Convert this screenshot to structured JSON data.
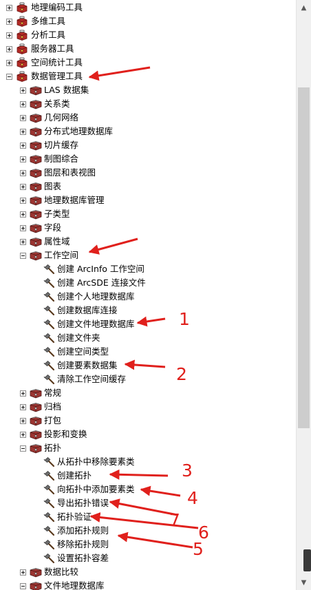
{
  "tree": {
    "items": [
      {
        "label": "地理编码工具",
        "level": 0,
        "expander": "plus",
        "icon": "toolbox-icon"
      },
      {
        "label": "多维工具",
        "level": 0,
        "expander": "plus",
        "icon": "toolbox-icon"
      },
      {
        "label": "分析工具",
        "level": 0,
        "expander": "plus",
        "icon": "toolbox-icon"
      },
      {
        "label": "服务器工具",
        "level": 0,
        "expander": "plus",
        "icon": "toolbox-icon"
      },
      {
        "label": "空间统计工具",
        "level": 0,
        "expander": "plus",
        "icon": "toolbox-icon"
      },
      {
        "label": "数据管理工具",
        "level": 0,
        "expander": "minus",
        "icon": "toolbox-icon"
      },
      {
        "label": "LAS 数据集",
        "level": 1,
        "expander": "plus",
        "icon": "toolset-icon"
      },
      {
        "label": "关系类",
        "level": 1,
        "expander": "plus",
        "icon": "toolset-icon"
      },
      {
        "label": "几何网络",
        "level": 1,
        "expander": "plus",
        "icon": "toolset-icon"
      },
      {
        "label": "分布式地理数据库",
        "level": 1,
        "expander": "plus",
        "icon": "toolset-icon"
      },
      {
        "label": "切片缓存",
        "level": 1,
        "expander": "plus",
        "icon": "toolset-icon"
      },
      {
        "label": "制图综合",
        "level": 1,
        "expander": "plus",
        "icon": "toolset-icon"
      },
      {
        "label": "图层和表视图",
        "level": 1,
        "expander": "plus",
        "icon": "toolset-icon"
      },
      {
        "label": "图表",
        "level": 1,
        "expander": "plus",
        "icon": "toolset-icon"
      },
      {
        "label": "地理数据库管理",
        "level": 1,
        "expander": "plus",
        "icon": "toolset-icon"
      },
      {
        "label": "子类型",
        "level": 1,
        "expander": "plus",
        "icon": "toolset-icon"
      },
      {
        "label": "字段",
        "level": 1,
        "expander": "plus",
        "icon": "toolset-icon"
      },
      {
        "label": "属性域",
        "level": 1,
        "expander": "plus",
        "icon": "toolset-icon"
      },
      {
        "label": "工作空间",
        "level": 1,
        "expander": "minus",
        "icon": "toolset-icon"
      },
      {
        "label": "创建 ArcInfo 工作空间",
        "level": 2,
        "expander": "none",
        "icon": "hammer-icon"
      },
      {
        "label": "创建 ArcSDE 连接文件",
        "level": 2,
        "expander": "none",
        "icon": "hammer-icon"
      },
      {
        "label": "创建个人地理数据库",
        "level": 2,
        "expander": "none",
        "icon": "hammer-icon"
      },
      {
        "label": "创建数据库连接",
        "level": 2,
        "expander": "none",
        "icon": "hammer-icon"
      },
      {
        "label": "创建文件地理数据库",
        "level": 2,
        "expander": "none",
        "icon": "hammer-icon"
      },
      {
        "label": "创建文件夹",
        "level": 2,
        "expander": "none",
        "icon": "hammer-icon"
      },
      {
        "label": "创建空间类型",
        "level": 2,
        "expander": "none",
        "icon": "hammer-icon"
      },
      {
        "label": "创建要素数据集",
        "level": 2,
        "expander": "none",
        "icon": "hammer-icon"
      },
      {
        "label": "清除工作空间缓存",
        "level": 2,
        "expander": "none",
        "icon": "hammer-icon"
      },
      {
        "label": "常规",
        "level": 1,
        "expander": "plus",
        "icon": "toolset-icon"
      },
      {
        "label": "归档",
        "level": 1,
        "expander": "plus",
        "icon": "toolset-icon"
      },
      {
        "label": "打包",
        "level": 1,
        "expander": "plus",
        "icon": "toolset-icon"
      },
      {
        "label": "投影和变换",
        "level": 1,
        "expander": "plus",
        "icon": "toolset-icon"
      },
      {
        "label": "拓扑",
        "level": 1,
        "expander": "minus",
        "icon": "toolset-icon"
      },
      {
        "label": "从拓扑中移除要素类",
        "level": 2,
        "expander": "none",
        "icon": "hammer-icon"
      },
      {
        "label": "创建拓扑",
        "level": 2,
        "expander": "none",
        "icon": "hammer-icon"
      },
      {
        "label": "向拓扑中添加要素类",
        "level": 2,
        "expander": "none",
        "icon": "hammer-icon"
      },
      {
        "label": "导出拓扑错误",
        "level": 2,
        "expander": "none",
        "icon": "hammer-icon"
      },
      {
        "label": "拓扑验证",
        "level": 2,
        "expander": "none",
        "icon": "hammer-icon"
      },
      {
        "label": "添加拓扑规则",
        "level": 2,
        "expander": "none",
        "icon": "hammer-icon"
      },
      {
        "label": "移除拓扑规则",
        "level": 2,
        "expander": "none",
        "icon": "hammer-icon"
      },
      {
        "label": "设置拓扑容差",
        "level": 2,
        "expander": "none",
        "icon": "hammer-icon"
      },
      {
        "label": "数据比较",
        "level": 1,
        "expander": "plus",
        "icon": "toolset-icon"
      },
      {
        "label": "文件地理数据库",
        "level": 1,
        "expander": "minus",
        "icon": "toolset-icon"
      }
    ]
  },
  "annotations": {
    "color": "#e0201c",
    "numbers": [
      "1",
      "2",
      "3",
      "4",
      "5",
      "6",
      "7"
    ]
  },
  "scrollbar": {
    "up_icon": "chevron-up-icon",
    "down_icon": "chevron-down-icon"
  }
}
